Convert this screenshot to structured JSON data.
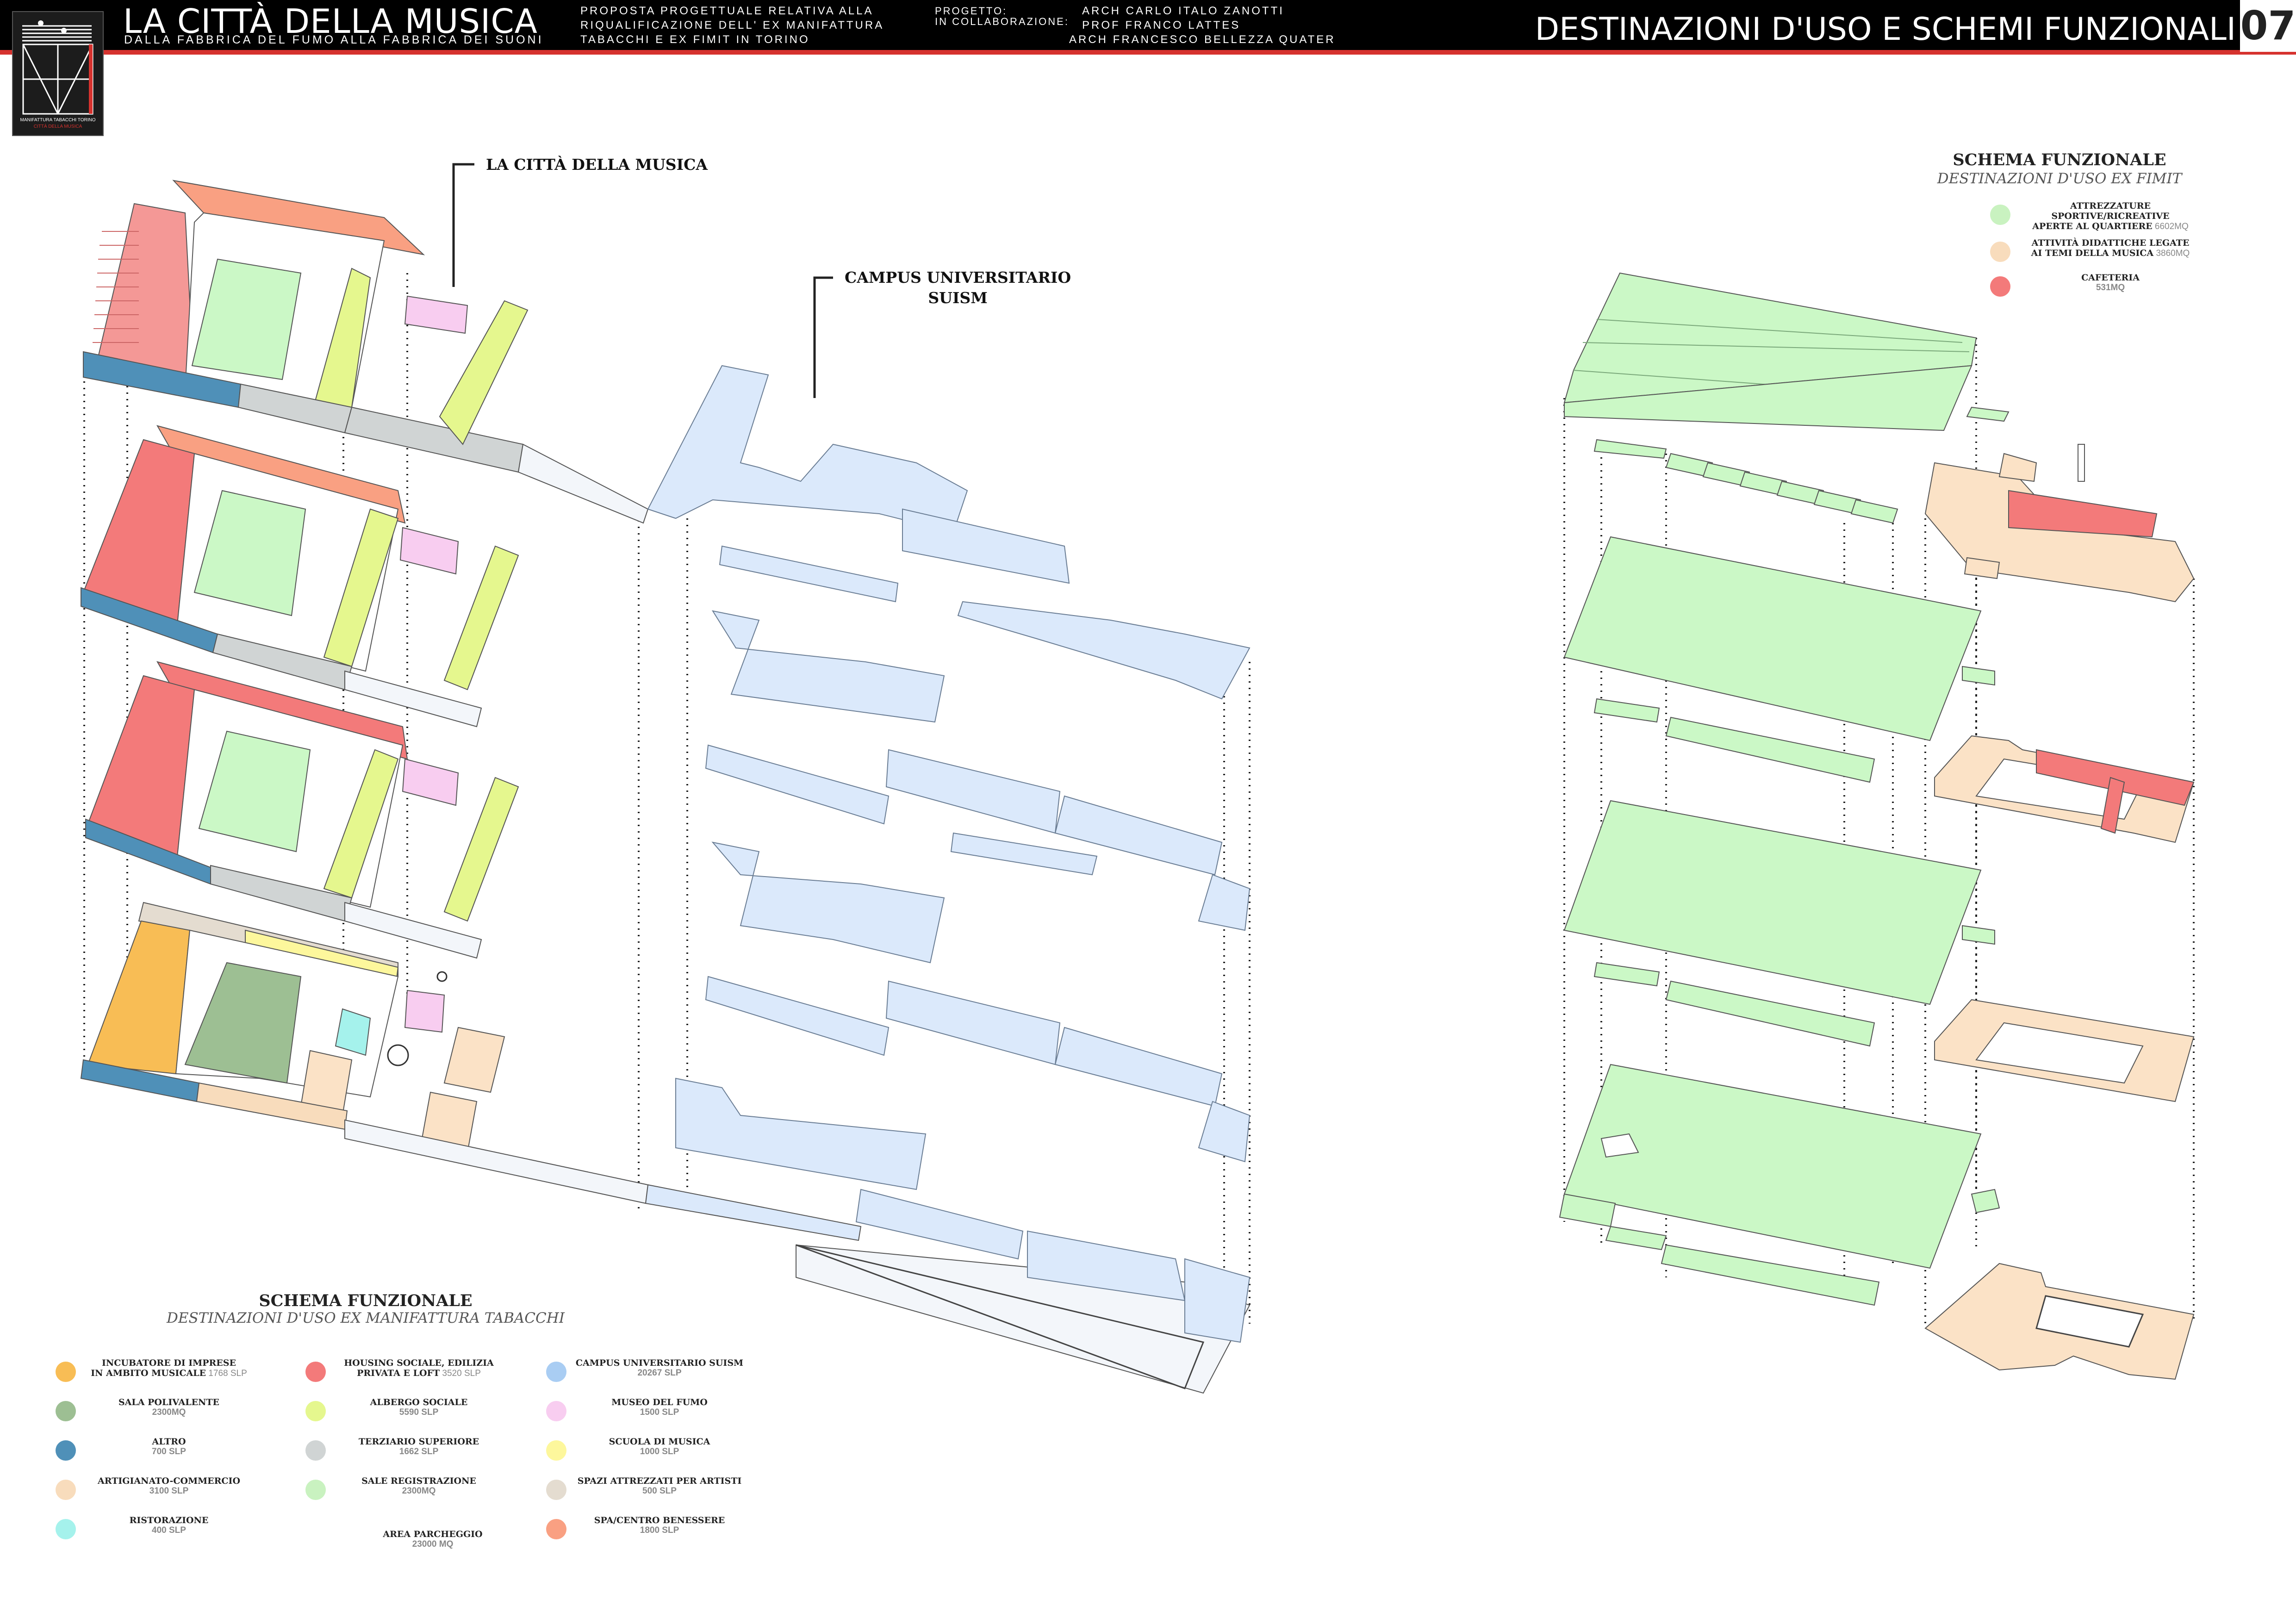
{
  "header": {
    "title": "LA CITTÀ DELLA MUSICA",
    "subtitle": "DALLA FABBRICA DEL FUMO ALLA FABBRICA DEI SUONI",
    "description_lines": [
      "PROPOSTA PROGETTUALE RELATIVA ALLA",
      "RIQUALIFICAZIONE DELL' EX MANIFATTURA",
      "TABACCHI E EX FIMIT IN TORINO"
    ],
    "project_label": "PROGETTO:",
    "collab_label": "IN COLLABORAZIONE:",
    "names": [
      "ARCH CARLO ITALO ZANOTTI",
      "PROF FRANCO LATTES",
      "ARCH FRANCESCO BELLEZZA QUATER"
    ],
    "section_title": "DESTINAZIONI D'USO E SCHEMI FUNZIONALI",
    "page_number": "07"
  },
  "logo": {
    "caption": "MANIFATTURA TABACCHI TORINO",
    "caption2": "CITTÀ DELLA MUSICA"
  },
  "callouts": {
    "citta_musica": "LA CITTÀ DELLA MUSICA",
    "campus_line1": "CAMPUS UNIVERSITARIO",
    "campus_line2": "SUISM"
  },
  "schema_left": {
    "title": "SCHEMA FUNZIONALE",
    "subtitle": "DESTINAZIONI D'USO EX MANIFATTURA TABACCHI"
  },
  "schema_right": {
    "title": "SCHEMA FUNZIONALE",
    "subtitle": "DESTINAZIONI D'USO EX FIMIT"
  },
  "legend_left": [
    {
      "name": "incubatore",
      "l1": "INCUBATORE DI IMPRESE",
      "l2": "IN AMBITO MUSICALE",
      "v": "1768 SLP",
      "inline": true,
      "color": "#f8bd55"
    },
    {
      "name": "sala-polivalente",
      "l1": "SALA POLIVALENTE",
      "l2": "",
      "v": "2300MQ",
      "color": "#9dbf93"
    },
    {
      "name": "altro",
      "l1": "ALTRO",
      "l2": "",
      "v": "700 SLP",
      "color": "#4f90b8"
    },
    {
      "name": "artigianato",
      "l1": "ARTIGIANATO-COMMERCIO",
      "l2": "",
      "v": "3100 SLP",
      "color": "#f8dcbc"
    },
    {
      "name": "ristorazione",
      "l1": "RISTORAZIONE",
      "l2": "",
      "v": "400 SLP",
      "color": "#a5f2ec"
    },
    {
      "name": "housing",
      "l1": "HOUSING SOCIALE, EDILIZIA",
      "l2": "PRIVATA E LOFT",
      "v": "3520 SLP",
      "inline": true,
      "color": "#f37a7a"
    },
    {
      "name": "albergo",
      "l1": "ALBERGO SOCIALE",
      "l2": "",
      "v": "5590 SLP",
      "color": "#e5f78e"
    },
    {
      "name": "terziario",
      "l1": "TERZIARIO SUPERIORE",
      "l2": "",
      "v": "1662 SLP",
      "color": "#d0d4d4"
    },
    {
      "name": "sale-registrazione",
      "l1": "SALE REGISTRAZIONE",
      "l2": "",
      "v": "2300MQ",
      "color": "#c9f2c0"
    },
    {
      "name": "parcheggio",
      "l1": "AREA PARCHEGGIO",
      "l2": "",
      "v": "23000 MQ",
      "color": ""
    },
    {
      "name": "campus",
      "l1": "CAMPUS UNIVERSITARIO SUISM",
      "l2": "",
      "v": "20267 SLP",
      "color": "#a9cdf3"
    },
    {
      "name": "museo",
      "l1": "MUSEO DEL FUMO",
      "l2": "",
      "v": "1500 SLP",
      "color": "#f8cdf0"
    },
    {
      "name": "scuola",
      "l1": "SCUOLA DI MUSICA",
      "l2": "",
      "v": "1000 SLP",
      "color": "#fdf79c"
    },
    {
      "name": "spazi-artisti",
      "l1": "SPAZI ATTREZZATI  PER ARTISTI",
      "l2": "",
      "v": "500 SLP",
      "color": "#e4dcd0"
    },
    {
      "name": "spa",
      "l1": "SPA/CENTRO BENESSERE",
      "l2": "",
      "v": "1800 SLP",
      "color": "#f9a082"
    }
  ],
  "legend_right": [
    {
      "name": "attrezzature",
      "l1": "ATTREZZATURE SPORTIVE/RICREATIVE",
      "l2": "APERTE AL QUARTIERE",
      "v": "6602MQ",
      "color": "#c9f2c0"
    },
    {
      "name": "attivita",
      "l1": "ATTIVITÀ DIDATTICHE LEGATE",
      "l2": "AI TEMI DELLA MUSICA",
      "v": "3860MQ",
      "color": "#f8dcbc"
    },
    {
      "name": "cafeteria",
      "l1": "CAFETERIA",
      "l2": "",
      "v": "531MQ",
      "color": "#f37a7a"
    }
  ]
}
